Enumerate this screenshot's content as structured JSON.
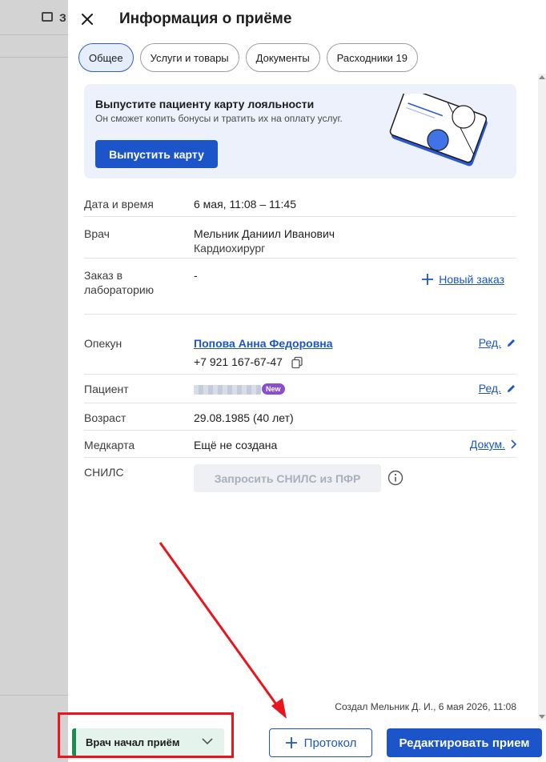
{
  "background": {
    "tab_fragment": "З"
  },
  "drawer": {
    "title": "Информация о приёме",
    "tabs": [
      {
        "label": "Общее",
        "active": true
      },
      {
        "label": "Услуги и товары",
        "active": false
      },
      {
        "label": "Документы",
        "active": false
      },
      {
        "label": "Расходники 19",
        "active": false
      }
    ]
  },
  "promo": {
    "title": "Выпустите пациенту карту лояльности",
    "subtitle": "Он сможет копить бонусы и тратить их на оплату услуг.",
    "button": "Выпустить карту"
  },
  "rows": {
    "datetime": {
      "label": "Дата и время",
      "value": "6 мая, 11:08 – 11:45"
    },
    "doctor": {
      "label": "Врач",
      "value": "Мельник Даниил Иванович",
      "subvalue": "Кардиохирург"
    },
    "lab": {
      "label_line1": "Заказ в",
      "label_line2": "лабораторию",
      "value": "-",
      "action": "Новый заказ"
    },
    "guardian": {
      "label": "Опекун",
      "name": "Попова Анна Федоровна",
      "phone": "+7 921 167-67-47",
      "action": "Ред."
    },
    "patient": {
      "label": "Пациент",
      "badge": "New",
      "action": "Ред."
    },
    "age": {
      "label": "Возраст",
      "value": "29.08.1985 (40 лет)"
    },
    "medcard": {
      "label": "Медкарта",
      "value": "Ещё не создана",
      "action": "Докум."
    },
    "snils": {
      "label": "СНИЛС",
      "button": "Запросить СНИЛС из ПФР"
    }
  },
  "created": "Создал Мельник Д. И., 6 мая 2026, 11:08",
  "footer": {
    "status": "Врач начал приём",
    "protocol": "Протокол",
    "edit": "Редактировать прием"
  },
  "colors": {
    "accent": "#1b55c9",
    "status_green": "#1f8b4f",
    "badge_purple": "#8a4fd0",
    "annotation_red": "#e8151d"
  }
}
